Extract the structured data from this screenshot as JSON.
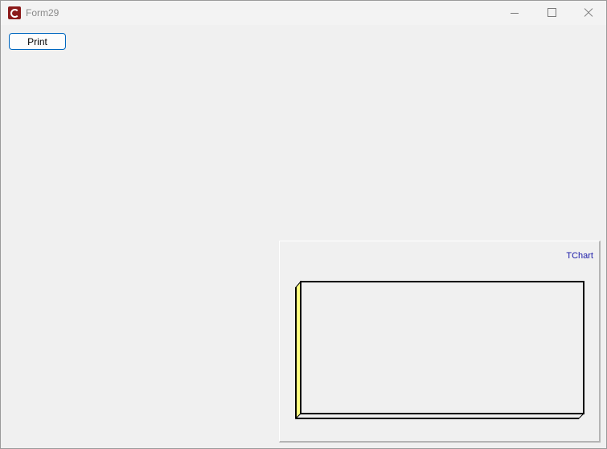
{
  "window": {
    "title": "Form29",
    "icon": "app-c-icon",
    "controls": {
      "minimize": "minimize-icon",
      "maximize": "maximize-icon",
      "close": "close-icon"
    }
  },
  "toolbar": {
    "print_label": "Print"
  },
  "chart": {
    "title": "TChart",
    "title_color": "#1a1aa8",
    "wall_color": "#ffff80",
    "frame_color": "#000000"
  }
}
